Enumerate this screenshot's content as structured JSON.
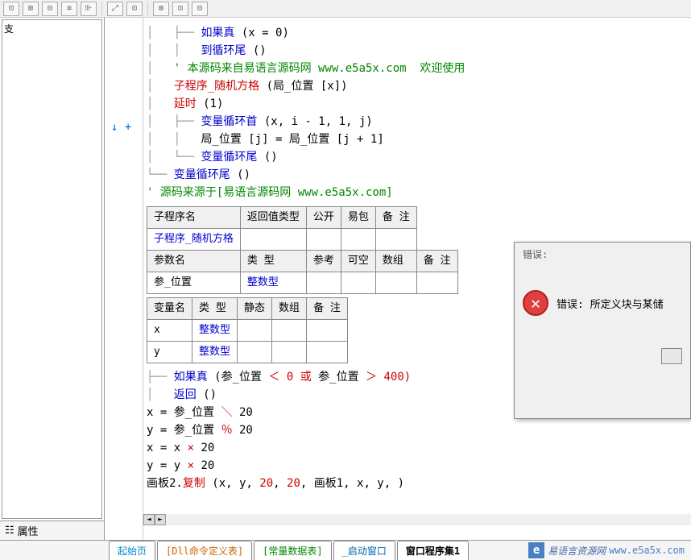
{
  "toolbar": {
    "buttons": [
      "⊡",
      "⊞",
      "⊟",
      "≡",
      "⊪",
      "⤢",
      "⊡",
      "⊞",
      "⊡",
      "⊟"
    ]
  },
  "left": {
    "truncated": "支",
    "prop_label": "属性"
  },
  "gutter": {
    "marks": "↓  +"
  },
  "code": {
    "l1_a": "如果真",
    "l1_b": " (x = 0)",
    "l2_a": "到循环尾",
    "l2_b": " ()",
    "l3": "' 本源码来自易语言源码网 www.e5a5x.com  欢迎使用",
    "l4_a": "子程序_随机方格",
    "l4_b": " (",
    "l4_c": "局_位置",
    "l4_d": " [x])",
    "l5_a": "延时",
    "l5_b": " (1)",
    "l6_a": "变量循环首",
    "l6_b": " (x, i - 1, 1, j)",
    "l7_a": "局_位置",
    "l7_b": " [j] = ",
    "l7_c": "局_位置",
    "l7_d": " [j + 1]",
    "l8_a": "变量循环尾",
    "l8_b": " ()",
    "l9_a": "变量循环尾",
    "l9_b": " ()",
    "l10": "' 源码来源于[易语言源码网 www.e5a5x.com]",
    "l11_a": "如果真",
    "l11_b": " (",
    "l11_c": "参_位置",
    "l11_d": " ＜ 0 或 ",
    "l11_e": "参_位置",
    "l11_f": " ＞ 400)",
    "l12_a": "返回",
    "l12_b": " ()",
    "l13": "x = 参_位置 ＼ 20",
    "l14": "y = 参_位置 ％ 20",
    "l15": "x = x × 20",
    "l16": "y = y × 20",
    "l17_a": "画板2.",
    "l17_b": "复制",
    "l17_c": " (x, y, ",
    "l17_d": "20",
    "l17_e": ", ",
    "l17_f": "20",
    "l17_g": ", 画板1, x, y, )"
  },
  "table1": {
    "headers": [
      "子程序名",
      "返回值类型",
      "公开",
      "易包",
      "备 注"
    ],
    "row1": [
      "子程序_随机方格",
      "",
      "",
      "",
      ""
    ],
    "headers2": [
      "参数名",
      "类 型",
      "参考",
      "可空",
      "数组",
      "备 注"
    ],
    "row2": [
      "参_位置",
      "整数型",
      "",
      "",
      "",
      ""
    ]
  },
  "table2": {
    "headers": [
      "变量名",
      "类 型",
      "静态",
      "数组",
      "备 注"
    ],
    "rows": [
      [
        "x",
        "整数型",
        "",
        "",
        ""
      ],
      [
        "y",
        "整数型",
        "",
        "",
        ""
      ]
    ]
  },
  "tabs": {
    "start": "起始页",
    "dll": "[Dll命令定义表]",
    "const": "[常量数据表]",
    "win": "_启动窗口",
    "proc": "窗口程序集1"
  },
  "dialog": {
    "title": "错误:",
    "message": "错误: 所定义块与某储"
  },
  "watermark": {
    "text1": "易语言资源网",
    "text2": "www.e5a5x.com"
  }
}
